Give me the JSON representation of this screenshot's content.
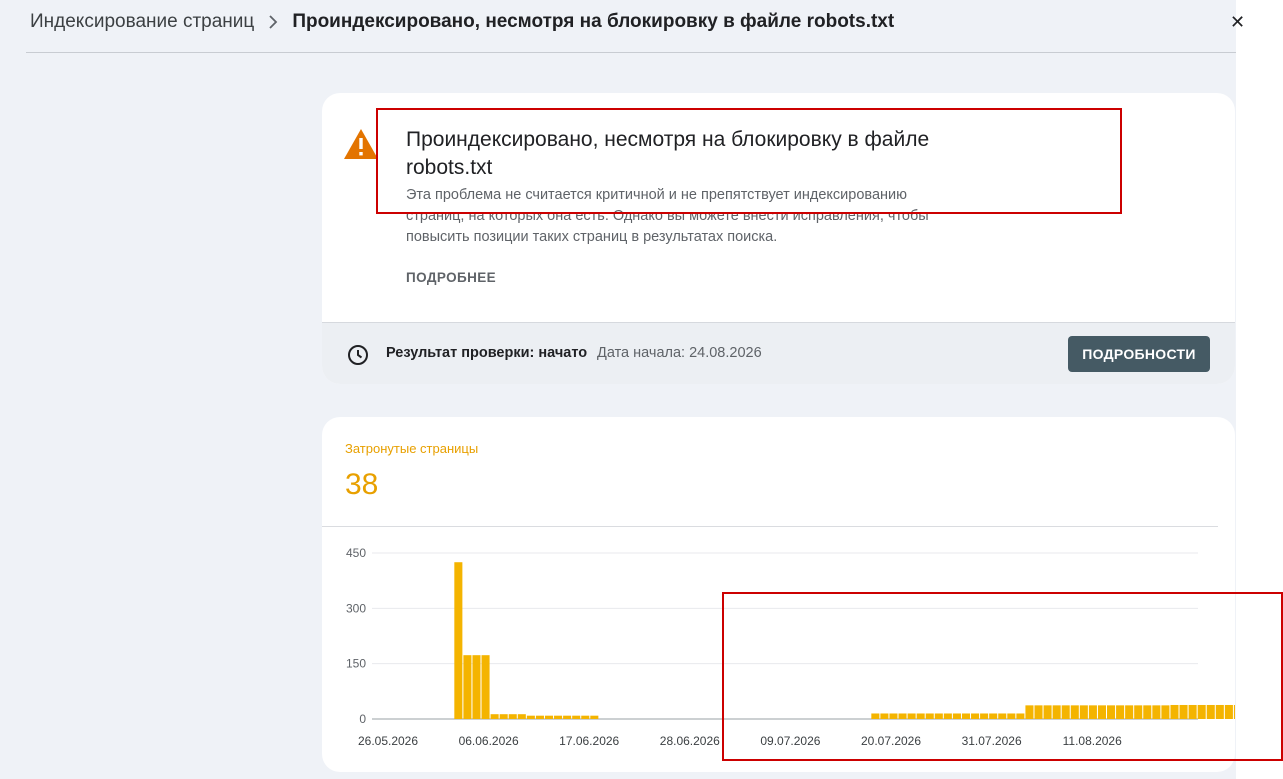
{
  "breadcrumb": {
    "parent": "Индексирование страниц",
    "current": "Проиндексировано, несмотря на блокировку в файле robots.txt"
  },
  "close_glyph": "✕",
  "issue": {
    "title": "Проиндексировано, несмотря на блокировку в файле robots.txt",
    "description": "Эта проблема не считается критичной и не препятствует индексированию страниц, на которых она есть. Однако вы можете внести исправления, чтобы повысить позиции таких страниц в результатах поиска.",
    "more_link": "ПОДРОБНЕЕ",
    "icon": "warning-icon"
  },
  "validation": {
    "icon": "clock-icon",
    "label": "Результат проверки: начато",
    "start_date": "Дата начала: 24.08.2026",
    "details_button": "ПОДРОБНОСТИ"
  },
  "metric": {
    "label": "Затронутые страницы",
    "value": "38"
  },
  "colors": {
    "accent": "#e8a000",
    "bar": "#f4b400",
    "warning": "#e37400",
    "button": "#455a64",
    "annotation": "#cc0000"
  },
  "chart_data": {
    "type": "bar",
    "title": "",
    "xlabel": "",
    "ylabel": "",
    "ylim": [
      0,
      450
    ],
    "y_ticks": [
      0,
      150,
      300,
      450
    ],
    "x_tick_labels": [
      "26.05.2026",
      "06.06.2026",
      "17.06.2026",
      "28.06.2026",
      "09.07.2026",
      "20.07.2026",
      "31.07.2026",
      "11.08.2026"
    ],
    "x_start": "26.05.2026",
    "x_end": "21.08.2026",
    "grid": true,
    "legend": "none",
    "series": [
      {
        "values": [
          0,
          0,
          0,
          0,
          0,
          425,
          173,
          173,
          173,
          13,
          13,
          13,
          13,
          9,
          9,
          9,
          9,
          9,
          9,
          9,
          9,
          0,
          0,
          0,
          0,
          0,
          0,
          0,
          0,
          0,
          0,
          0,
          0,
          0,
          0,
          0,
          0,
          0,
          0,
          0,
          0,
          0,
          0,
          0,
          0,
          0,
          0,
          0,
          0,
          0,
          0,
          15,
          15,
          15,
          15,
          15,
          15,
          15,
          15,
          15,
          15,
          15,
          15,
          15,
          15,
          15,
          15,
          15,
          37,
          37,
          37,
          37,
          37,
          37,
          37,
          37,
          37,
          37,
          37,
          37,
          37,
          37,
          37,
          37,
          38,
          38,
          38,
          38,
          38,
          38,
          38,
          38,
          38,
          38,
          38,
          38,
          38,
          38
        ]
      }
    ]
  }
}
